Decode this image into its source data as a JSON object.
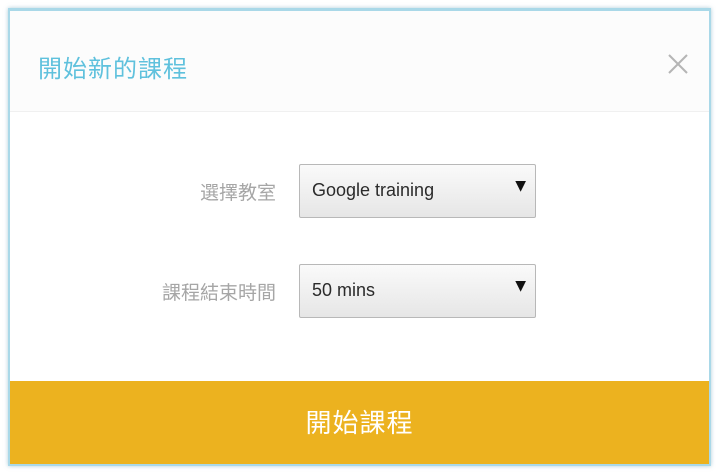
{
  "dialog": {
    "title": "開始新的課程",
    "close_icon": "close-icon",
    "accent_color": "#5fc1dd"
  },
  "form": {
    "classroom": {
      "label": "選擇教室",
      "selected": "Google training"
    },
    "end_time": {
      "label": "課程結束時間",
      "selected": "50 mins"
    },
    "dropdown_icon": "caret-down-icon"
  },
  "footer": {
    "start_label": "開始課程",
    "button_color": "#ecb21f"
  }
}
